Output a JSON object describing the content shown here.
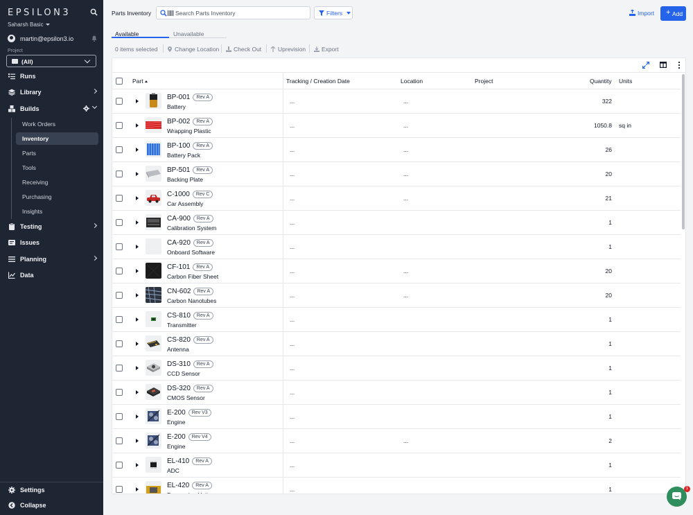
{
  "sidebar": {
    "logo": "EPSILON3",
    "workspace": "Saharsh Basic",
    "user_email": "martin@epsilon3.io",
    "project_label": "Project",
    "project_value": "(All)",
    "nav": {
      "runs": "Runs",
      "library": "Library",
      "builds": "Builds",
      "testing": "Testing",
      "issues": "Issues",
      "planning": "Planning",
      "data": "Data"
    },
    "builds_sub": [
      "Work Orders",
      "Inventory",
      "Parts",
      "Tools",
      "Receiving",
      "Purchasing",
      "Insights"
    ],
    "settings": "Settings",
    "collapse": "Collapse"
  },
  "header": {
    "title": "Parts Inventory",
    "search_placeholder": "Search Parts Inventory",
    "filters_label": "Filters",
    "import_label": "Import",
    "add_label": "Add"
  },
  "tabs": {
    "available": "Available",
    "unavailable": "Unavailable"
  },
  "toolbar": {
    "selected": "0 items selected",
    "change_location": "Change Location",
    "check_out": "Check Out",
    "uprevision": "Uprevision",
    "export": "Export"
  },
  "table": {
    "columns": {
      "part": "Part",
      "tracking": "Tracking / Creation Date",
      "location": "Location",
      "project": "Project",
      "quantity": "Quantity",
      "units": "Units"
    },
    "rows": [
      {
        "num": "BP-001",
        "rev": "Rev A",
        "name": "Battery",
        "track": "...",
        "loc": "...",
        "qty": "322",
        "units": "",
        "thumb": "battery"
      },
      {
        "num": "BP-002",
        "rev": "Rev A",
        "name": "Wrapping Plastic",
        "track": "...",
        "loc": "...",
        "qty": "1050.8",
        "units": "sq in",
        "thumb": "plastic"
      },
      {
        "num": "BP-100",
        "rev": "Rev A",
        "name": "Battery Pack",
        "track": "...",
        "loc": "...",
        "qty": "26",
        "units": "",
        "thumb": "pack"
      },
      {
        "num": "BP-501",
        "rev": "Rev A",
        "name": "Backing Plate",
        "track": "...",
        "loc": "...",
        "qty": "20",
        "units": "",
        "thumb": "plate"
      },
      {
        "num": "C-1000",
        "rev": "Rev C",
        "name": "Car Assembly",
        "track": "...",
        "loc": "...",
        "qty": "21",
        "units": "",
        "thumb": "car"
      },
      {
        "num": "CA-900",
        "rev": "Rev A",
        "name": "Calibration System",
        "track": "...",
        "loc": "",
        "qty": "1",
        "units": "",
        "thumb": "calib"
      },
      {
        "num": "CA-920",
        "rev": "Rev A",
        "name": "Onboard Software",
        "track": "...",
        "loc": "",
        "qty": "1",
        "units": "",
        "thumb": "blank"
      },
      {
        "num": "CF-101",
        "rev": "Rev A",
        "name": "Carbon Fiber Sheet",
        "track": "...",
        "loc": "...",
        "qty": "20",
        "units": "",
        "thumb": "carbon"
      },
      {
        "num": "CN-602",
        "rev": "Rev A",
        "name": "Carbon Nanotubes",
        "track": "...",
        "loc": "...",
        "qty": "20",
        "units": "",
        "thumb": "nano"
      },
      {
        "num": "CS-810",
        "rev": "Rev A",
        "name": "Transmitter",
        "track": "...",
        "loc": "",
        "qty": "1",
        "units": "",
        "thumb": "chip"
      },
      {
        "num": "CS-820",
        "rev": "Rev A",
        "name": "Antenna",
        "track": "...",
        "loc": "",
        "qty": "1",
        "units": "",
        "thumb": "antenna"
      },
      {
        "num": "DS-310",
        "rev": "Rev A",
        "name": "CCD Sensor",
        "track": "...",
        "loc": "",
        "qty": "1",
        "units": "",
        "thumb": "sensor"
      },
      {
        "num": "DS-320",
        "rev": "Rev A",
        "name": "CMOS Sensor",
        "track": "...",
        "loc": "",
        "qty": "1",
        "units": "",
        "thumb": "cmos"
      },
      {
        "num": "E-200",
        "rev": "Rev V3",
        "name": "Engine",
        "track": "...",
        "loc": "",
        "qty": "1",
        "units": "",
        "thumb": "engine"
      },
      {
        "num": "E-200",
        "rev": "Rev V4",
        "name": "Engine",
        "track": "...",
        "loc": "...",
        "qty": "2",
        "units": "",
        "thumb": "engine"
      },
      {
        "num": "EL-410",
        "rev": "Rev A",
        "name": "ADC",
        "track": "...",
        "loc": "",
        "qty": "1",
        "units": "",
        "thumb": "ic"
      },
      {
        "num": "EL-420",
        "rev": "Rev A",
        "name": "Processing Unit",
        "track": "...",
        "loc": "",
        "qty": "1",
        "units": "",
        "thumb": "cpu"
      }
    ]
  },
  "chat": {
    "badge": "1"
  }
}
